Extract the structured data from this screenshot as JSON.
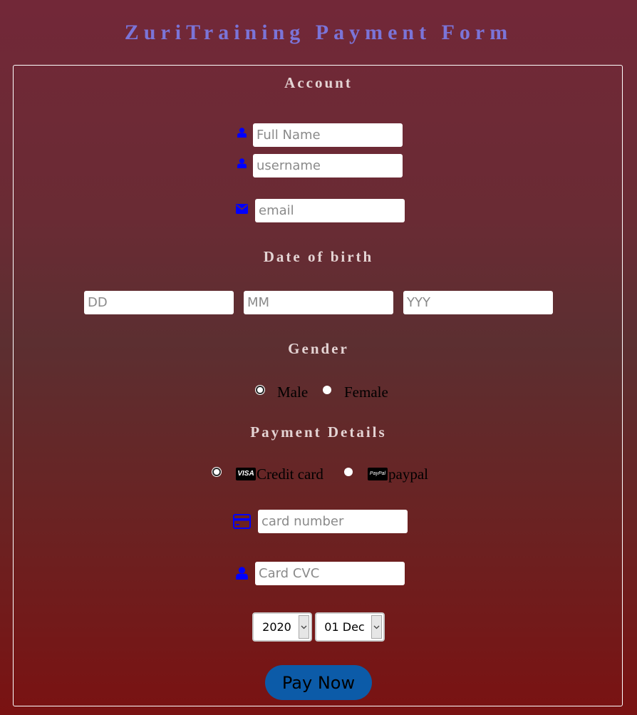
{
  "page_title": "ZuriTraining Payment Form",
  "account": {
    "heading": "Account",
    "full_name_placeholder": "Full Name",
    "username_placeholder": "username",
    "email_placeholder": "email"
  },
  "dob": {
    "heading": "Date of birth",
    "day_placeholder": "DD",
    "month_placeholder": "MM",
    "year_placeholder": "YYY"
  },
  "gender": {
    "heading": "Gender",
    "options": [
      {
        "label": "Male",
        "selected": true
      },
      {
        "label": "Female",
        "selected": false
      }
    ]
  },
  "payment": {
    "heading": "Payment Details",
    "methods": [
      {
        "label": "Credit card",
        "badge": "VISA",
        "icon": "visa-card-icon",
        "selected": true
      },
      {
        "label": "paypal",
        "badge": "PayPal",
        "icon": "paypal-card-icon",
        "selected": false
      }
    ],
    "card_number_placeholder": "card number",
    "card_cvc_placeholder": "Card CVC",
    "year_select": "2020",
    "date_select": "01 Dec",
    "submit_label": "Pay Now"
  },
  "colors": {
    "title": "#7b74d8",
    "heading": "#e4d4d4",
    "icon": "#0000ff",
    "button": "#0c5ba8"
  }
}
